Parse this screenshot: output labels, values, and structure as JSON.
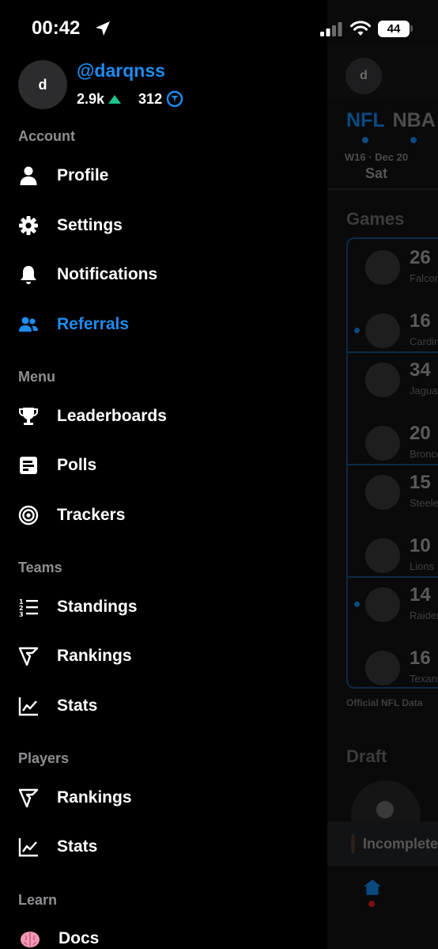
{
  "status_bar": {
    "time": "00:42",
    "battery": "44",
    "icons": [
      "location-arrow-icon",
      "cellular-signal-icon",
      "wifi-icon",
      "battery-icon"
    ]
  },
  "profile": {
    "avatar_initial": "d",
    "username": "@darqnss",
    "points": "2.9k",
    "points_icon": "trend-up-icon",
    "secondary_count": "312",
    "secondary_icon": "badge-icon"
  },
  "colors": {
    "accent": "#1d8cf0",
    "trend_up": "#1ec28b",
    "section_heading": "#8e8e93",
    "drawer_background": "#000000"
  },
  "sections": {
    "account": "Account",
    "menu": "Menu",
    "teams": "Teams",
    "players": "Players",
    "learn": "Learn"
  },
  "items": {
    "profile": {
      "label": "Profile",
      "icon": "person-icon"
    },
    "settings": {
      "label": "Settings",
      "icon": "gear-icon"
    },
    "notifications": {
      "label": "Notifications",
      "icon": "bell-icon"
    },
    "referrals": {
      "label": "Referrals",
      "icon": "people-icon",
      "active": true
    },
    "leaderboards": {
      "label": "Leaderboards",
      "icon": "trophy-icon"
    },
    "polls": {
      "label": "Polls",
      "icon": "poll-icon"
    },
    "trackers": {
      "label": "Trackers",
      "icon": "target-icon"
    },
    "team_standings": {
      "label": "Standings",
      "icon": "numbered-list-icon"
    },
    "team_rankings": {
      "label": "Rankings",
      "icon": "rankings-icon"
    },
    "team_stats": {
      "label": "Stats",
      "icon": "line-chart-icon"
    },
    "player_rankings": {
      "label": "Rankings",
      "icon": "rankings-icon"
    },
    "player_stats": {
      "label": "Stats",
      "icon": "line-chart-icon"
    },
    "docs": {
      "label": "Docs",
      "icon": "brain-icon"
    }
  },
  "background_app": {
    "avatar_initial": "d",
    "leagues": [
      "NFL",
      "NBA"
    ],
    "date_label": "W16 · Dec 20",
    "day_label": "Sat",
    "games_heading": "Games",
    "games": [
      {
        "score": "26",
        "team": "Falcons"
      },
      {
        "score": "16",
        "team": "Cardinals"
      },
      {
        "score": "34",
        "team": "Jaguars"
      },
      {
        "score": "20",
        "team": "Broncos"
      },
      {
        "score": "15",
        "team": "Steelers"
      },
      {
        "score": "10",
        "team": "Lions"
      },
      {
        "score": "14",
        "team": "Raiders"
      },
      {
        "score": "16",
        "team": "Texans"
      }
    ],
    "footnote": "Official NFL Data",
    "draft_heading": "Draft",
    "banner_text": "Incomplete"
  }
}
